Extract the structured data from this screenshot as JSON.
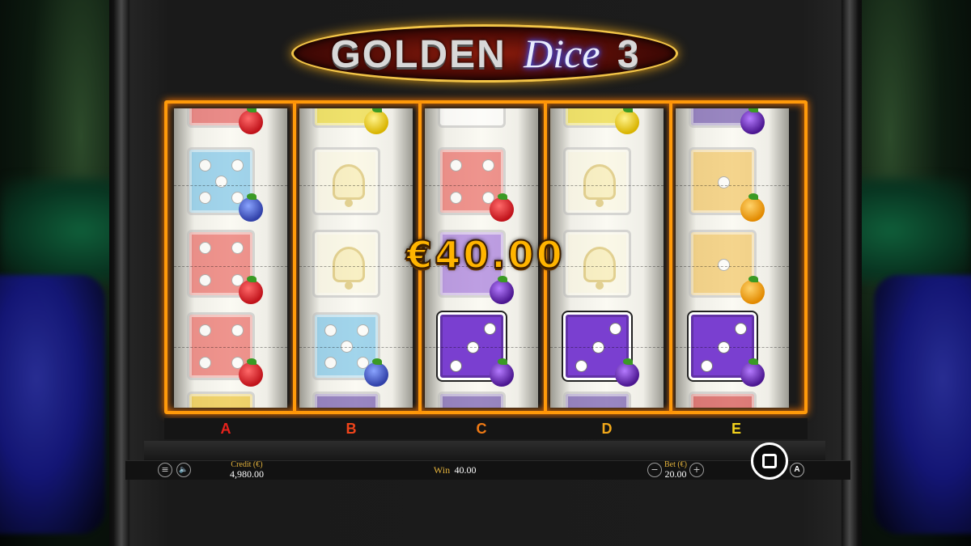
{
  "game": {
    "title_part1": "GOLDEN",
    "title_part2": "Dice",
    "title_part3": "3"
  },
  "win_display": "€40.00",
  "reels": [
    {
      "label": "A",
      "label_color": "#e8231c"
    },
    {
      "label": "B",
      "label_color": "#f0441a"
    },
    {
      "label": "C",
      "label_color": "#f07a14"
    },
    {
      "label": "D",
      "label_color": "#f1a81a"
    },
    {
      "label": "E",
      "label_color": "#f3d21c"
    }
  ],
  "controls": {
    "menu_icon": "≡",
    "sound_icon": "🔈",
    "credit_label": "Credit (€)",
    "credit_value": "4,980.00",
    "win_label": "Win",
    "win_value": "40.00",
    "bet_label": "Bet (€)",
    "bet_value": "20.00",
    "bet_minus": "−",
    "bet_plus": "+",
    "autoplay_label": "A"
  },
  "colors": {
    "reel_frame": "#ff9a0a",
    "win_text": "#ffb400",
    "label_gold": "#e3b23c"
  }
}
